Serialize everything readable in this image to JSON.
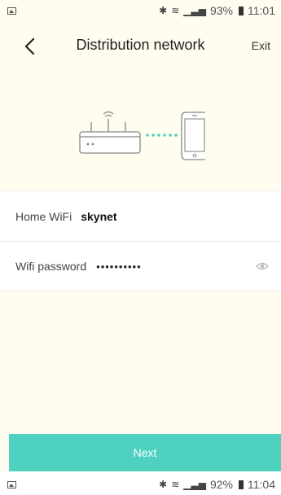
{
  "status_top": {
    "battery": "93%",
    "time": "11:01"
  },
  "header": {
    "title": "Distribution network",
    "exit_label": "Exit"
  },
  "form": {
    "wifi_label": "Home WiFi",
    "wifi_value": "skynet",
    "password_label": "Wifi password",
    "password_value": "••••••••••"
  },
  "next_label": "Next",
  "status_bottom": {
    "battery": "92%",
    "time": "11:04"
  },
  "colors": {
    "accent": "#4fd1bf",
    "background_tint": "#fffdf0"
  }
}
